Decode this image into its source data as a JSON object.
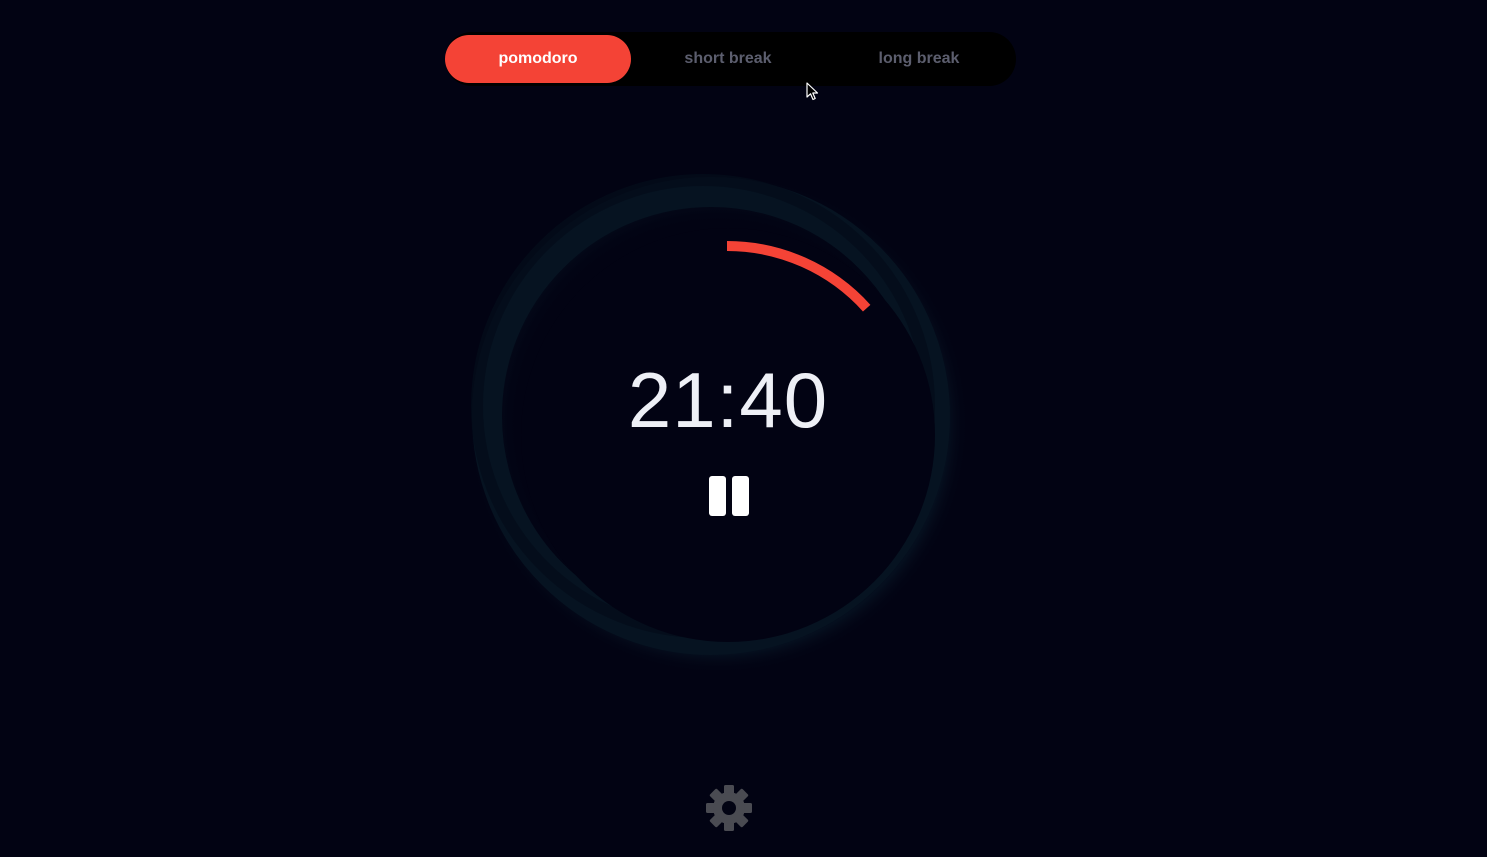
{
  "modes": {
    "items": [
      {
        "label": "pomodoro",
        "active": true
      },
      {
        "label": "short break",
        "active": false
      },
      {
        "label": "long break",
        "active": false
      }
    ]
  },
  "timer": {
    "display": "21:40",
    "progress_elapsed_fraction": 0.1333,
    "state": "running",
    "control_icon": "pause-icon"
  },
  "settings": {
    "icon": "gear-icon"
  },
  "colors": {
    "background": "#020313",
    "accent": "#f44336",
    "switch_background": "#000000",
    "inactive_text": "#5c5e6e",
    "timer_text": "#eef0f6",
    "dial_ring": "#071523",
    "settings_icon": "#4a4b52"
  }
}
